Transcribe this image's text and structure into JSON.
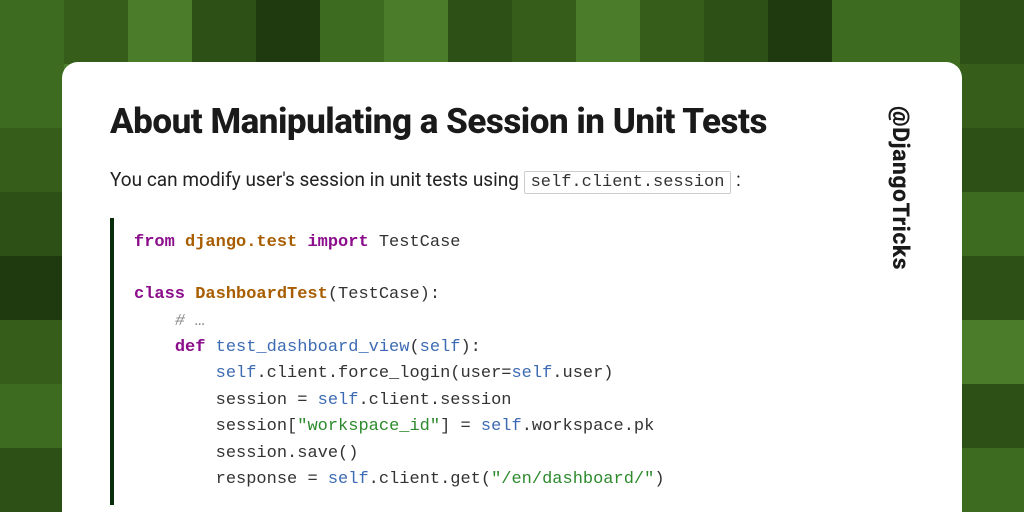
{
  "handle": "@DjangoTricks",
  "title": "About Manipulating a Session in Unit Tests",
  "intro_before": "You can modify user's session in unit tests using ",
  "intro_code": "self.client.session",
  "intro_after": " :",
  "code": {
    "l1": {
      "kw1": "from",
      "mod": "django.test",
      "kw2": "import",
      "name": "TestCase"
    },
    "l3": {
      "kw": "class",
      "name": "DashboardTest",
      "base": "(TestCase):"
    },
    "l4": {
      "com": "# …"
    },
    "l5": {
      "kw": "def",
      "fn": "test_dashboard_view",
      "args": "self",
      "end": "):"
    },
    "l6": {
      "self1": "self",
      "t1": ".client.force_login(user=",
      "self2": "self",
      "t2": ".user)"
    },
    "l7": {
      "t1": "session = ",
      "self": "self",
      "t2": ".client.session"
    },
    "l8": {
      "t1": "session[",
      "str": "\"workspace_id\"",
      "t2": "] = ",
      "self": "self",
      "t3": ".workspace.pk"
    },
    "l9": {
      "t": "session.save()"
    },
    "l10": {
      "t1": "response = ",
      "self": "self",
      "t2": ".client.get(",
      "str": "\"/en/dashboard/\"",
      "t3": ")"
    }
  }
}
